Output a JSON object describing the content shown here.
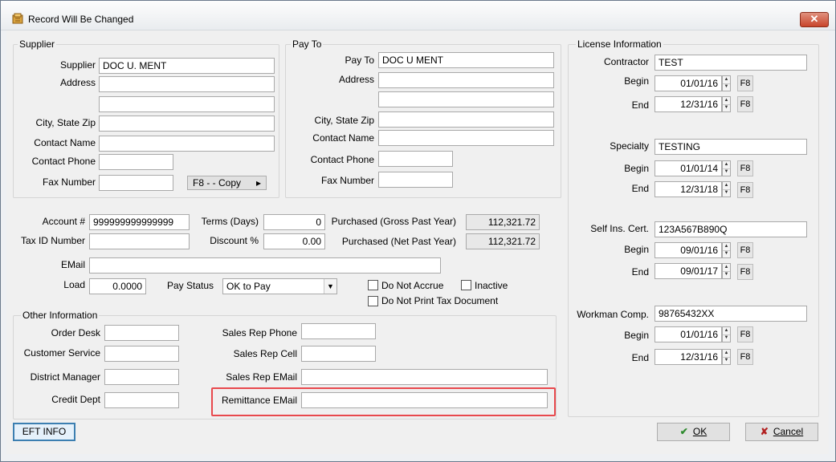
{
  "window": {
    "title": "Record Will Be Changed",
    "close_label": "✕"
  },
  "supplier": {
    "legend": "Supplier",
    "supplier_label": "Supplier",
    "supplier_value": "DOC U. MENT",
    "address_label": "Address",
    "address1": "",
    "address2": "",
    "citystate_label": "City, State  Zip",
    "citystate_value": "",
    "contact_name_label": "Contact Name",
    "contact_name_value": "",
    "contact_phone_label": "Contact Phone",
    "contact_phone_value": "",
    "fax_label": "Fax Number",
    "fax_value": "",
    "copy_button": "F8 - - Copy",
    "copy_arrow": "▸"
  },
  "payto": {
    "legend": "Pay To",
    "payto_label": "Pay To",
    "payto_value": "DOC U MENT",
    "address_label": "Address",
    "address1": "",
    "address2": "",
    "citystate_label": "City, State  Zip",
    "citystate_value": "",
    "contact_name_label": "Contact Name",
    "contact_name_value": "",
    "contact_phone_label": "Contact Phone",
    "contact_phone_value": "",
    "fax_label": "Fax Number",
    "fax_value": ""
  },
  "account": {
    "account_label": "Account #",
    "account_value": "999999999999999",
    "taxid_label": "Tax ID Number",
    "taxid_value": "",
    "terms_label": "Terms (Days)",
    "terms_value": "0",
    "discount_label": "Discount %",
    "discount_value": "0.00",
    "purchased_gross_label": "Purchased (Gross Past Year)",
    "purchased_gross_value": "112,321.72",
    "purchased_net_label": "Purchased (Net Past Year)",
    "purchased_net_value": "112,321.72",
    "email_label": "EMail",
    "email_value": "",
    "load_label": "Load",
    "load_value": "0.0000",
    "paystatus_label": "Pay Status",
    "paystatus_value": "OK to Pay",
    "donotaccrue_label": "Do Not Accrue",
    "inactive_label": "Inactive",
    "donotprint_label": "Do Not Print Tax Document"
  },
  "other": {
    "legend": "Other Information",
    "order_desk_label": "Order Desk",
    "order_desk_value": "",
    "customer_service_label": "Customer Service",
    "customer_service_value": "",
    "district_manager_label": "District Manager",
    "district_manager_value": "",
    "credit_dept_label": "Credit Dept",
    "credit_dept_value": "",
    "sales_rep_phone_label": "Sales Rep Phone",
    "sales_rep_phone_value": "",
    "sales_rep_cell_label": "Sales Rep Cell",
    "sales_rep_cell_value": "",
    "sales_rep_email_label": "Sales Rep EMail",
    "sales_rep_email_value": "",
    "remittance_email_label": "Remittance EMail",
    "remittance_email_value": ""
  },
  "license": {
    "legend": "License Information",
    "contractor_label": "Contractor",
    "contractor_value": "TEST",
    "contractor_begin": "01/01/16",
    "contractor_end": "12/31/16",
    "specialty_label": "Specialty",
    "specialty_value": "TESTING",
    "specialty_begin": "01/01/14",
    "specialty_end": "12/31/18",
    "selfins_label": "Self Ins. Cert.",
    "selfins_value": "123A567B890Q",
    "selfins_begin": "09/01/16",
    "selfins_end": "09/01/17",
    "workman_label": "Workman Comp.",
    "workman_value": "98765432XX",
    "workman_begin": "01/01/16",
    "workman_end": "12/31/16",
    "begin_label": "Begin",
    "end_label": "End",
    "f8_label": "F8"
  },
  "buttons": {
    "eft_info": "EFT INFO",
    "ok": "OK",
    "cancel": "Cancel",
    "ok_icon": "✔",
    "cancel_icon": "✘"
  },
  "colors": {
    "highlight": "#e8494d",
    "ok_check": "#2e8b2e",
    "cancel_x": "#b22222"
  }
}
